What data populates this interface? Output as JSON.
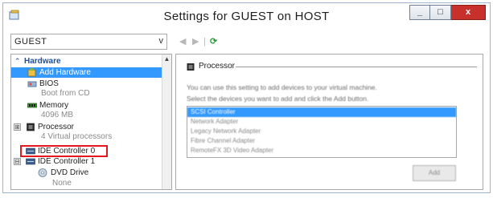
{
  "window": {
    "title": "Settings for GUEST on HOST",
    "controls": {
      "minimize": "_",
      "maximize": "□",
      "close": "x"
    }
  },
  "vm_selector": {
    "value": "GUEST",
    "arrow": "v"
  },
  "tree": {
    "header": {
      "chevron": "⌃",
      "label": "Hardware"
    },
    "items": [
      {
        "label": "Add Hardware",
        "selected": true,
        "icon": "add-hardware-icon"
      },
      {
        "label": "BIOS",
        "sub": "Boot from CD",
        "icon": "bios-icon"
      },
      {
        "label": "Memory",
        "sub": "4096 MB",
        "icon": "memory-icon"
      },
      {
        "label": "Processor",
        "sub": "4 Virtual processors",
        "icon": "processor-icon",
        "expander": "⊞"
      },
      {
        "label": "IDE Controller 0",
        "icon": "ide-controller-icon",
        "highlighted": true
      },
      {
        "label": "IDE Controller 1",
        "icon": "ide-controller-icon",
        "expander": "⊟"
      },
      {
        "label": "DVD Drive",
        "sub": "None",
        "icon": "dvd-drive-icon"
      }
    ]
  },
  "nav": {
    "back": "◀",
    "forward": "▶",
    "separator": "|",
    "refresh": "⟳"
  },
  "panel": {
    "section_title": "Processor",
    "description_line1": "You can use this setting to add devices to your virtual machine.",
    "description_line2": "Select the devices you want to add and click the Add button.",
    "devices": [
      {
        "label": "SCSI Controller",
        "selected": true
      },
      {
        "label": "Network Adapter"
      },
      {
        "label": "Legacy Network Adapter"
      },
      {
        "label": "Fibre Channel Adapter"
      },
      {
        "label": "RemoteFX 3D Video Adapter"
      }
    ],
    "add_button": "Add"
  },
  "colors": {
    "selection": "#3399ff",
    "header_text": "#1d4f9c",
    "highlight_border": "#e3181f",
    "close_button": "#c7302b"
  }
}
